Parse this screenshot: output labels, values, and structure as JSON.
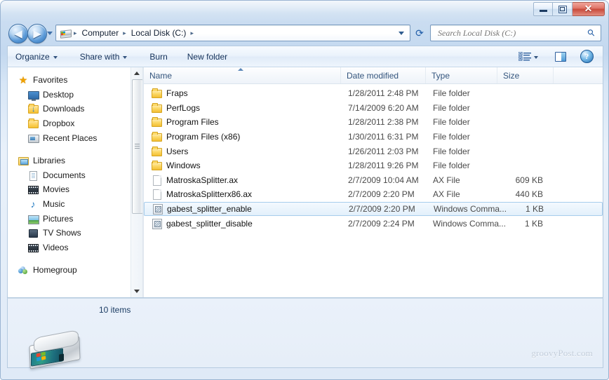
{
  "window": {
    "buttons": {
      "minimize": "Minimize",
      "maximize": "Maximize",
      "close": "✕"
    }
  },
  "address": {
    "back_label": "◀",
    "forward_label": "▶",
    "history_label": "Recent pages",
    "drive_icon": "local-disk-icon",
    "crumbs": [
      "Computer",
      "Local Disk (C:)"
    ],
    "separator": "▸",
    "dropdown_label": "Previous locations",
    "refresh_label": "↻"
  },
  "search": {
    "placeholder": "Search Local Disk (C:)",
    "value": "",
    "icon": "search-icon"
  },
  "toolbar": {
    "organize": "Organize",
    "share_with": "Share with",
    "burn": "Burn",
    "new_folder": "New folder",
    "change_view_label": "Change your view",
    "preview_pane_label": "Show the preview pane",
    "help_label": "?"
  },
  "navigation": {
    "groups": [
      {
        "title": "Favorites",
        "icon": "star-icon",
        "items": [
          {
            "label": "Desktop",
            "icon": "desktop-icon"
          },
          {
            "label": "Downloads",
            "icon": "downloads-icon"
          },
          {
            "label": "Dropbox",
            "icon": "folder-icon"
          },
          {
            "label": "Recent Places",
            "icon": "recent-places-icon"
          }
        ]
      },
      {
        "title": "Libraries",
        "icon": "libraries-icon",
        "items": [
          {
            "label": "Documents",
            "icon": "documents-icon"
          },
          {
            "label": "Movies",
            "icon": "movies-icon"
          },
          {
            "label": "Music",
            "icon": "music-icon"
          },
          {
            "label": "Pictures",
            "icon": "pictures-icon"
          },
          {
            "label": "TV Shows",
            "icon": "tv-icon"
          },
          {
            "label": "Videos",
            "icon": "videos-icon"
          }
        ]
      },
      {
        "title": "Homegroup",
        "icon": "homegroup-icon",
        "items": []
      }
    ]
  },
  "columns": [
    {
      "label": "Name",
      "sorted": true,
      "sort_direction": "asc"
    },
    {
      "label": "Date modified",
      "sorted": false
    },
    {
      "label": "Type",
      "sorted": false
    },
    {
      "label": "Size",
      "sorted": false
    }
  ],
  "files": [
    {
      "name": "Fraps",
      "date": "1/28/2011 2:48 PM",
      "type": "File folder",
      "size": "",
      "icon": "folder-icon",
      "selected": false
    },
    {
      "name": "PerfLogs",
      "date": "7/14/2009 6:20 AM",
      "type": "File folder",
      "size": "",
      "icon": "folder-icon",
      "selected": false
    },
    {
      "name": "Program Files",
      "date": "1/28/2011 2:38 PM",
      "type": "File folder",
      "size": "",
      "icon": "folder-icon",
      "selected": false
    },
    {
      "name": "Program Files (x86)",
      "date": "1/30/2011 6:31 PM",
      "type": "File folder",
      "size": "",
      "icon": "folder-icon",
      "selected": false
    },
    {
      "name": "Users",
      "date": "1/26/2011 2:03 PM",
      "type": "File folder",
      "size": "",
      "icon": "folder-icon",
      "selected": false
    },
    {
      "name": "Windows",
      "date": "1/28/2011 9:26 PM",
      "type": "File folder",
      "size": "",
      "icon": "folder-icon",
      "selected": false
    },
    {
      "name": "MatroskaSplitter.ax",
      "date": "2/7/2009 10:04 AM",
      "type": "AX File",
      "size": "609 KB",
      "icon": "blank-file-icon",
      "selected": false
    },
    {
      "name": "MatroskaSplitterx86.ax",
      "date": "2/7/2009 2:20 PM",
      "type": "AX File",
      "size": "440 KB",
      "icon": "blank-file-icon",
      "selected": false
    },
    {
      "name": "gabest_splitter_enable",
      "date": "2/7/2009 2:20 PM",
      "type": "Windows Comma...",
      "size": "1 KB",
      "icon": "command-script-icon",
      "selected": true
    },
    {
      "name": "gabest_splitter_disable",
      "date": "2/7/2009 2:24 PM",
      "type": "Windows Comma...",
      "size": "1 KB",
      "icon": "command-script-icon",
      "selected": false
    }
  ],
  "details": {
    "item_count": "10 items",
    "drive_icon": "local-disk-icon"
  },
  "watermark": "groovyPost.com",
  "colors": {
    "accent": "#2f6fb3",
    "selection_border": "#a7cdec",
    "frame": "#c3d8ef",
    "close_button": "#c94b3c"
  }
}
